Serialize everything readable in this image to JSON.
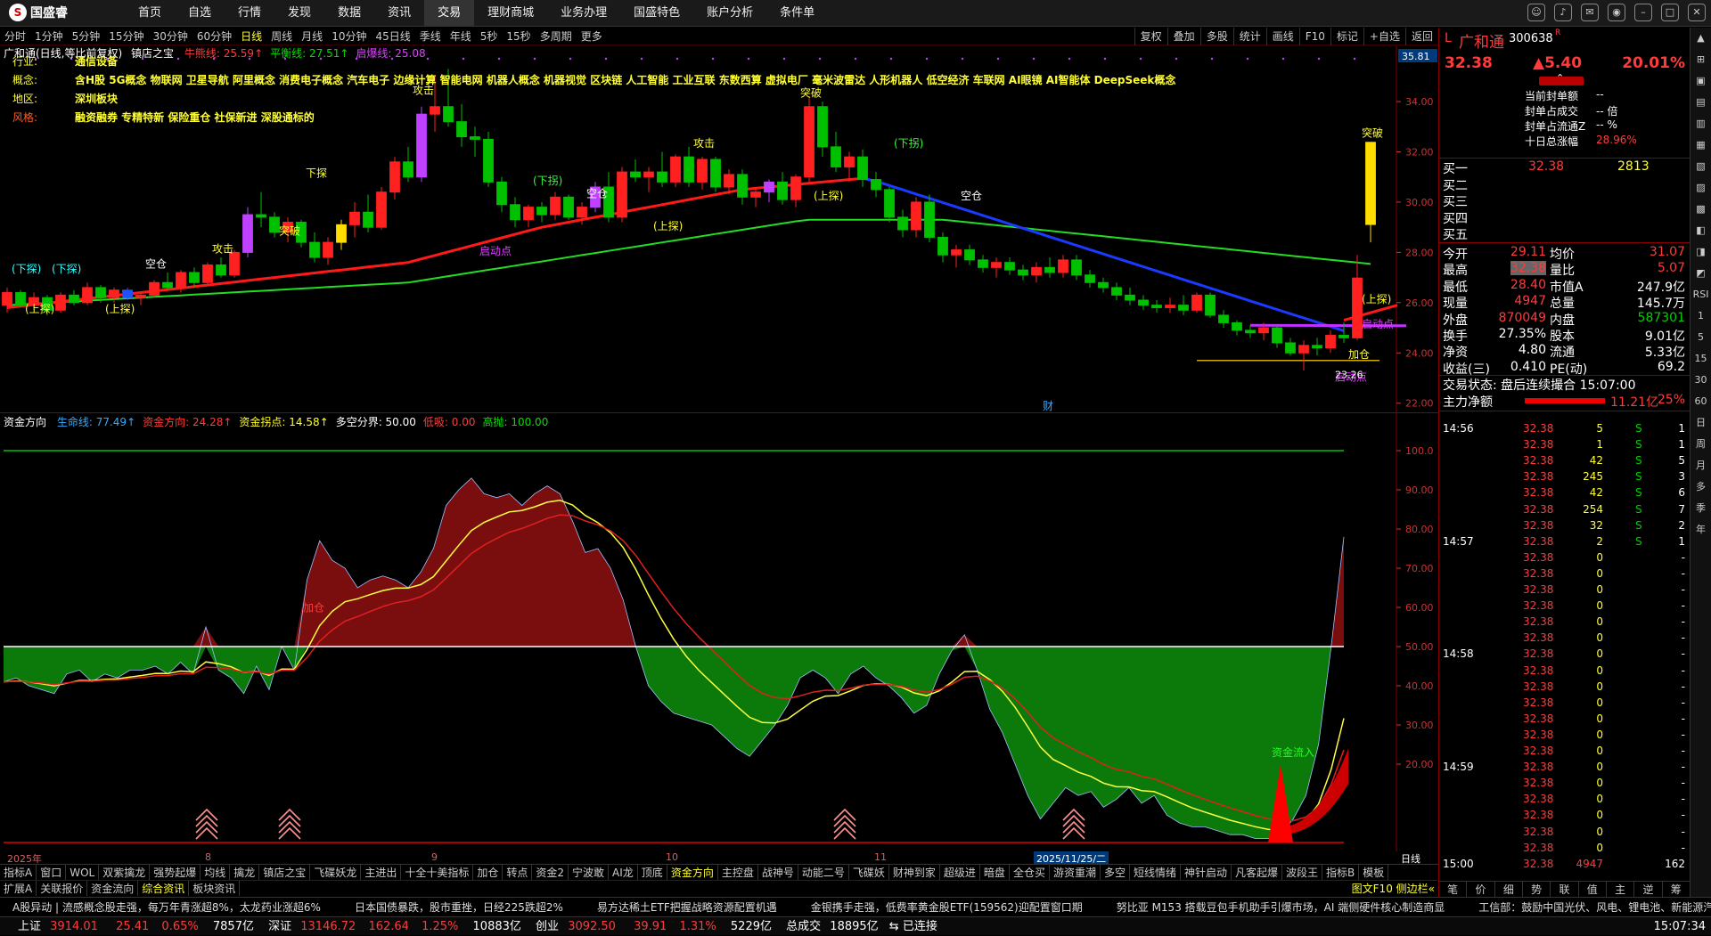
{
  "app": {
    "logo_text": "国盛睿",
    "menu": [
      "首页",
      "自选",
      "行情",
      "发现",
      "数据",
      "资讯",
      "交易",
      "理财商城",
      "业务办理",
      "国盛特色",
      "账户分析",
      "条件单"
    ],
    "active_menu_index": 6,
    "window_controls": [
      "chat",
      "bell",
      "mail",
      "user",
      "minimize",
      "maximize",
      "close"
    ]
  },
  "periods": [
    "分时",
    "1分钟",
    "5分钟",
    "15分钟",
    "30分钟",
    "60分钟",
    "日线",
    "周线",
    "月线",
    "10分钟",
    "45日线",
    "季线",
    "年线",
    "5秒",
    "15秒",
    "多周期",
    "更多"
  ],
  "active_period_index": 6,
  "tools": [
    "复权",
    "叠加",
    "多股",
    "统计",
    "画线",
    "F10",
    "标记",
    "+自选",
    "返回"
  ],
  "kchart": {
    "title": "广和通(日线,等比前复权)",
    "indicator_name": "镇店之宝",
    "legend": [
      {
        "label": "牛熊线: 25.59",
        "color": "#ff3b3b",
        "arrow": "↑"
      },
      {
        "label": "平衡线: 27.51",
        "color": "#00e000",
        "arrow": "↑"
      },
      {
        "label": "启爆线: 25.08",
        "color": "#e040ff",
        "arrow": ""
      }
    ],
    "info": [
      {
        "key": "行业:",
        "value": "通信设备"
      },
      {
        "key": "概念:",
        "value": "含H股 5G概念 物联网 卫星导航 阿里概念 消费电子概念 汽车电子 边缘计算 智能电网 机器人概念 机器视觉 区块链 人工智能 工业互联 东数西算 虚拟电厂 毫米波雷达 人形机器人 低空经济 车联网 AI眼镜 AI智能体 DeepSeek概念"
      },
      {
        "key": "地区:",
        "value": "深圳板块"
      },
      {
        "key": "风格:",
        "value": "融资融券 专精特新 保险重仓 社保新进 深股通标的"
      }
    ],
    "price_ticks": [
      "34.00",
      "32.00",
      "30.00",
      "28.00",
      "26.00",
      "24.00",
      "22.00"
    ],
    "top_price_label": "35.81",
    "low_label": "23.26",
    "annotations": [
      "(下探)",
      "(上探)",
      "突破",
      "空仓",
      "攻击",
      "下探",
      "启动点",
      "(下拐)",
      "加仓",
      "财"
    ]
  },
  "indchart": {
    "name": "资金方向",
    "legend": [
      {
        "label": "生命线: 77.49",
        "color": "#3af",
        "arrow": "↑"
      },
      {
        "label": "资金方向: 24.28",
        "color": "#ff3b3b",
        "arrow": "↑"
      },
      {
        "label": "资金拐点: 14.58",
        "color": "#ff3",
        "arrow": "↑"
      },
      {
        "label": "多空分界: 50.00",
        "color": "#fff",
        "arrow": ""
      },
      {
        "label": "低吸: 0.00",
        "color": "#ff3b3b",
        "arrow": ""
      },
      {
        "label": "高抛: 100.00",
        "color": "#00e000",
        "arrow": ""
      }
    ],
    "ticks": [
      "100.0",
      "90.00",
      "80.00",
      "70.00",
      "60.00",
      "50.00",
      "40.00",
      "30.00",
      "20.00"
    ],
    "flow_in_label": "资金流入"
  },
  "date_axis": [
    {
      "label": "2025年",
      "pos": 0.005
    },
    {
      "label": "8",
      "pos": 0.147
    },
    {
      "label": "9",
      "pos": 0.309
    },
    {
      "label": "10",
      "pos": 0.477
    },
    {
      "label": "11",
      "pos": 0.626
    },
    {
      "label": "2025/11/25/二",
      "pos": 0.74
    }
  ],
  "date_axis_right": "日线",
  "bottom_tabs": [
    "指标A",
    "窗口",
    "WOL",
    "双紫擒龙",
    "强势起爆",
    "均线",
    "擒龙",
    "镇店之宝",
    "飞碟妖龙",
    "主进出",
    "十全十美指标",
    "加仓",
    "转点",
    "资金2",
    "宁波敢",
    "AI龙",
    "顶底",
    "资金方向",
    "主控盘",
    "战神号",
    "动能二号",
    "飞碟妖",
    "财神到家",
    "超级进",
    "暗盘",
    "全仓买",
    "游资重潮",
    "多空",
    "短线情绪",
    "神针启动",
    "凡客起爆",
    "波段王",
    "指标B",
    "模板"
  ],
  "active_bottom_tab": 17,
  "bottom_tabs2": [
    "扩展A",
    "关联报价",
    "资金流向",
    "综合资讯",
    "板块资讯"
  ],
  "active_bottom_tab2": 3,
  "f10_link": "图文F10 侧边栏«",
  "ticker": [
    "A股异动 | 流感概念股走强，每万年青涨超8%，太龙药业涨超6%",
    "日本国债暴跌，股市重挫，日经225跌超2%",
    "易方达稀土ETF把握战略资源配置机遇",
    "金银携手走强，低费率黄金股ETF(159562)迎配置窗口期",
    "努比亚 M153 搭载豆包手机助手引爆市场，AI 端侧硬件核心制造商显",
    "工信部：鼓励中国光伏、风电、锂电池、新能源汽"
  ],
  "status": {
    "sh_label": "上证",
    "sh_val": "3914.01",
    "sh_chg": "25.41",
    "sh_pct": "0.65%",
    "sh_amt": "7857亿",
    "sz_label": "深证",
    "sz_val": "13146.72",
    "sz_chg": "162.64",
    "sz_pct": "1.25%",
    "sz_amt": "10883亿",
    "cy_label": "创业",
    "cy_val": "3092.50",
    "cy_chg": "39.91",
    "cy_pct": "1.31%",
    "cy_amt": "5229亿",
    "total_label": "总成交",
    "total_val": "18895亿",
    "conn": "已连接",
    "time": "15:07:34"
  },
  "quote": {
    "prefix": "L",
    "name": "广和通",
    "code": "300638",
    "r_badge": "R",
    "price": "32.38",
    "change": "▲5.40",
    "pct": "20.01%",
    "seal": [
      {
        "k": "当前封单额",
        "v": "--"
      },
      {
        "k": "封单占成交",
        "v": "-- 倍"
      },
      {
        "k": "封单占流通Z",
        "v": "-- %"
      },
      {
        "k": "十日总涨幅",
        "v": "28.96%"
      }
    ],
    "book": [
      {
        "k": "买一",
        "p": "32.38",
        "v": "2813"
      },
      {
        "k": "买二",
        "p": "",
        "v": ""
      },
      {
        "k": "买三",
        "p": "",
        "v": ""
      },
      {
        "k": "买四",
        "p": "",
        "v": ""
      },
      {
        "k": "买五",
        "p": "",
        "v": ""
      }
    ],
    "stats": [
      [
        "今开",
        "29.11",
        "均价",
        "31.07"
      ],
      [
        "最高",
        "32.38",
        "量比",
        "5.07"
      ],
      [
        "最低",
        "28.40",
        "市值A",
        "247.9亿"
      ],
      [
        "现量",
        "4947",
        "总量",
        "145.7万"
      ],
      [
        "外盘",
        "870049",
        "内盘",
        "587301"
      ],
      [
        "换手",
        "27.35%",
        "股本",
        "9.01亿"
      ],
      [
        "净资",
        "4.80",
        "流通",
        "5.33亿"
      ],
      [
        "收益(三)",
        "0.410",
        "PE(动)",
        "69.2"
      ]
    ],
    "trade_state": "交易状态: 盘后连续撮合 15:07:00",
    "net_label": "主力净额",
    "net_val": "11.21亿",
    "net_pct": "25%",
    "ticks": [
      {
        "t": "14:56",
        "p": "32.38",
        "v": "5",
        "bs": "S",
        "n": "1"
      },
      {
        "t": "",
        "p": "32.38",
        "v": "1",
        "bs": "S",
        "n": "1"
      },
      {
        "t": "",
        "p": "32.38",
        "v": "42",
        "bs": "S",
        "n": "5"
      },
      {
        "t": "",
        "p": "32.38",
        "v": "245",
        "bs": "S",
        "n": "3"
      },
      {
        "t": "",
        "p": "32.38",
        "v": "42",
        "bs": "S",
        "n": "6"
      },
      {
        "t": "",
        "p": "32.38",
        "v": "254",
        "bs": "S",
        "n": "7"
      },
      {
        "t": "",
        "p": "32.38",
        "v": "32",
        "bs": "S",
        "n": "2"
      },
      {
        "t": "14:57",
        "p": "32.38",
        "v": "2",
        "bs": "S",
        "n": "1"
      },
      {
        "t": "",
        "p": "32.38",
        "v": "0",
        "bs": "",
        "n": "-"
      },
      {
        "t": "",
        "p": "32.38",
        "v": "0",
        "bs": "",
        "n": "-"
      },
      {
        "t": "",
        "p": "32.38",
        "v": "0",
        "bs": "",
        "n": "-"
      },
      {
        "t": "",
        "p": "32.38",
        "v": "0",
        "bs": "",
        "n": "-"
      },
      {
        "t": "",
        "p": "32.38",
        "v": "0",
        "bs": "",
        "n": "-"
      },
      {
        "t": "",
        "p": "32.38",
        "v": "0",
        "bs": "",
        "n": "-"
      },
      {
        "t": "14:58",
        "p": "32.38",
        "v": "0",
        "bs": "",
        "n": "-"
      },
      {
        "t": "",
        "p": "32.38",
        "v": "0",
        "bs": "",
        "n": "-"
      },
      {
        "t": "",
        "p": "32.38",
        "v": "0",
        "bs": "",
        "n": "-"
      },
      {
        "t": "",
        "p": "32.38",
        "v": "0",
        "bs": "",
        "n": "-"
      },
      {
        "t": "",
        "p": "32.38",
        "v": "0",
        "bs": "",
        "n": "-"
      },
      {
        "t": "",
        "p": "32.38",
        "v": "0",
        "bs": "",
        "n": "-"
      },
      {
        "t": "",
        "p": "32.38",
        "v": "0",
        "bs": "",
        "n": "-"
      },
      {
        "t": "14:59",
        "p": "32.38",
        "v": "0",
        "bs": "",
        "n": "-"
      },
      {
        "t": "",
        "p": "32.38",
        "v": "0",
        "bs": "",
        "n": "-"
      },
      {
        "t": "",
        "p": "32.38",
        "v": "0",
        "bs": "",
        "n": "-"
      },
      {
        "t": "",
        "p": "32.38",
        "v": "0",
        "bs": "",
        "n": "-"
      },
      {
        "t": "",
        "p": "32.38",
        "v": "0",
        "bs": "",
        "n": "-"
      },
      {
        "t": "",
        "p": "32.38",
        "v": "0",
        "bs": "",
        "n": "-"
      },
      {
        "t": "15:00",
        "p": "32.38",
        "v": "4947",
        "bs": "",
        "n": "162"
      }
    ],
    "tabs": [
      "笔",
      "价",
      "细",
      "势",
      "联",
      "值",
      "主",
      "逆",
      "筹"
    ]
  },
  "sidebar": [
    "▲",
    "⊞",
    "▣",
    "▤",
    "▥",
    "▦",
    "▧",
    "▨",
    "▩",
    "◧",
    "◨",
    "◩",
    "RSI",
    "1",
    "5",
    "15",
    "30",
    "60",
    "日",
    "周",
    "月",
    "多",
    "季",
    "年"
  ],
  "colors": {
    "up": "#ff3b3b",
    "down": "#00d000",
    "accent": "#ff3",
    "bg": "#000000"
  }
}
